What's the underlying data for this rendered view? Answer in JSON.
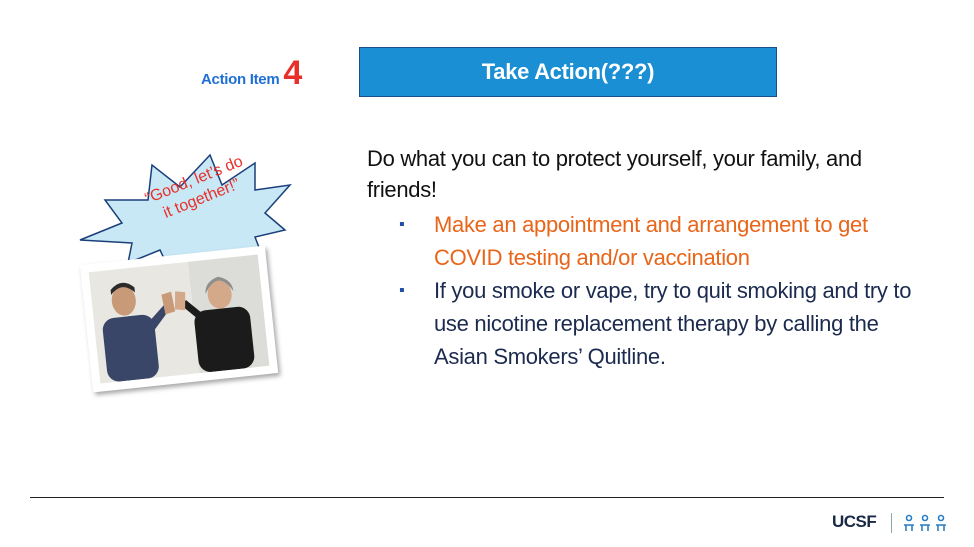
{
  "action_item": {
    "label": "Action Item",
    "number": "4"
  },
  "title": "Take Action(???)",
  "intro": "Do what you can to protect yourself, your family, and friends!",
  "bullets": [
    {
      "text": "Make an appointment and arrangement to get COVID testing and/or vaccination",
      "color": "#e8651a"
    },
    {
      "text": "If you smoke or vape, try to quit smoking and try to use nicotine replacement therapy by calling the Asian Smokers’ Quitline.",
      "color": "#1b2a4e"
    }
  ],
  "callout": {
    "line1": "“Good, let’s do",
    "line2": "it together!”"
  },
  "logo": {
    "text": "UCSF"
  },
  "colors": {
    "title_bg": "#1b8fd3",
    "accent_red": "#e8302b",
    "accent_blue": "#1f6fd6"
  },
  "icons": [
    "square-bullet-icon",
    "speech-burst-icon",
    "asian-smokers-quitline-logo-icon"
  ]
}
